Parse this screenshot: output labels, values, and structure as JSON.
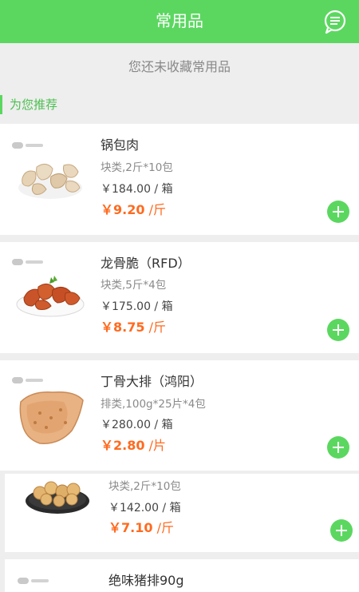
{
  "header": {
    "title": "常用品"
  },
  "favorites": {
    "empty_message": "您还未收藏常用品"
  },
  "recommend": {
    "title": "为您推荐"
  },
  "products": [
    {
      "name": "锅包肉",
      "spec": "块类,2斤*10包",
      "box_price": "￥184.00 / 箱",
      "unit_price": "￥9.20",
      "unit": " /斤",
      "image": "guobaorou-photo"
    },
    {
      "name": "龙骨脆（RFD）",
      "spec": "块类,5斤*4包",
      "box_price": "￥175.00 / 箱",
      "unit_price": "￥8.75",
      "unit": " /斤",
      "image": "longgucui-photo"
    },
    {
      "name": "丁骨大排（鸿阳）",
      "spec": "排类,100g*25片*4包",
      "box_price": "￥280.00 / 箱",
      "unit_price": "￥2.80",
      "unit": " /片",
      "image": "dingu-dapai-photo"
    },
    {
      "name": "",
      "spec": "块类,2斤*10包",
      "box_price": "￥142.00 / 箱",
      "unit_price": "￥7.10",
      "unit": " /斤",
      "image": "fried-nuggets-photo"
    },
    {
      "name": "绝味猪排90g"
    }
  ],
  "colors": {
    "accent": "#5bd760",
    "price": "#ff6a1f"
  },
  "icons": {
    "header_action": "message-icon",
    "add": "plus-icon",
    "brand": "brand-logo"
  }
}
